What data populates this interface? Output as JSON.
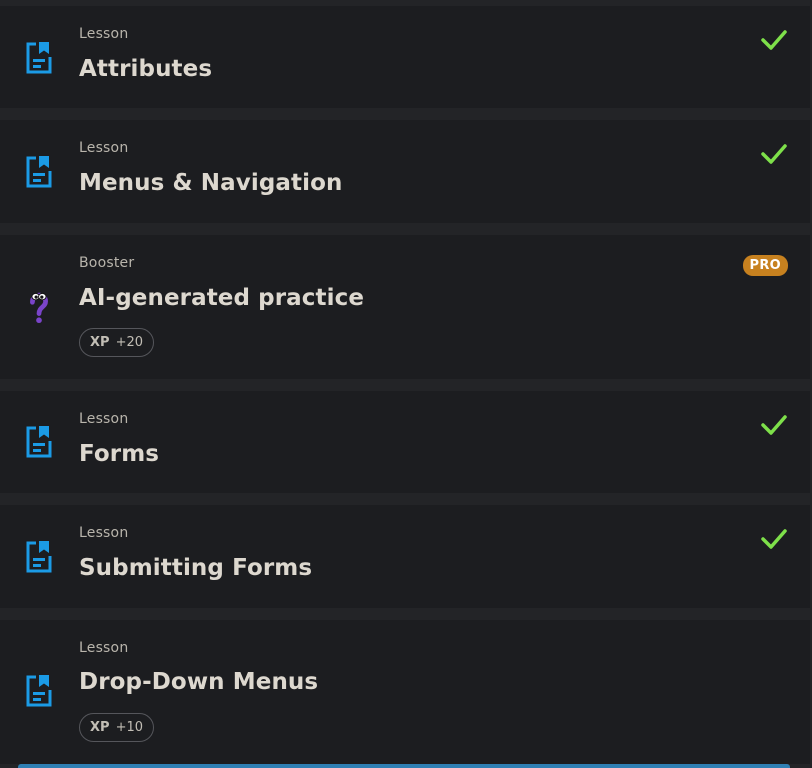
{
  "colors": {
    "lesson_icon": "#1b9be6",
    "check": "#7ee04a",
    "pro_badge": "#c7811f",
    "booster_icon": "#7a44c9"
  },
  "items": [
    {
      "type": "Lesson",
      "title": "Attributes",
      "status": "completed",
      "icon": "lesson-document-icon"
    },
    {
      "type": "Lesson",
      "title": "Menus & Navigation",
      "status": "completed",
      "icon": "lesson-document-icon"
    },
    {
      "type": "Booster",
      "title": "AI-generated practice",
      "badge": "PRO",
      "xp_label": "XP",
      "xp_value": "+20",
      "icon": "booster-question-icon"
    },
    {
      "type": "Lesson",
      "title": "Forms",
      "status": "completed",
      "icon": "lesson-document-icon"
    },
    {
      "type": "Lesson",
      "title": "Submitting Forms",
      "status": "completed",
      "icon": "lesson-document-icon"
    },
    {
      "type": "Lesson",
      "title": "Drop-Down Menus",
      "xp_label": "XP",
      "xp_value": "+10",
      "icon": "lesson-document-icon"
    }
  ]
}
